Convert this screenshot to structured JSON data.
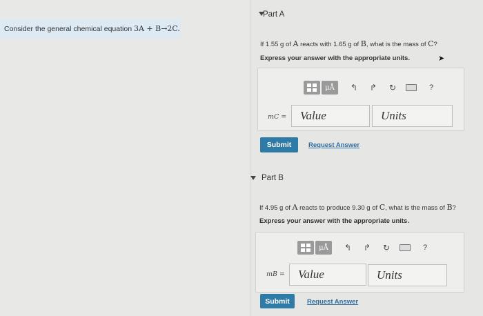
{
  "context": {
    "text": "Consider the general chemical equation ",
    "equation": "3A + B→2C."
  },
  "part_a": {
    "title": "Part A",
    "question_pre": "If 1.55 g of ",
    "q_a": "A",
    "question_mid1": " reacts with 1.65 g of ",
    "q_b": "B",
    "question_mid2": ", what is the mass of ",
    "q_c": "C",
    "question_end": "?",
    "instruction": "Express your answer with the appropriate units.",
    "var_label": "mC =",
    "value_placeholder": "Value",
    "units_placeholder": "Units",
    "submit_label": "Submit",
    "request_label": "Request Answer"
  },
  "part_b": {
    "title": "Part B",
    "question_pre": "If 4.95 g of ",
    "q_a": "A",
    "question_mid1": " reacts to produce 9.30 g of ",
    "q_c": "C",
    "question_mid2": ", what is the mass of ",
    "q_b": "B",
    "question_end": "?",
    "instruction": "Express your answer with the appropriate units.",
    "var_label": "mB =",
    "value_placeholder": "Value",
    "units_placeholder": "Units",
    "submit_label": "Submit",
    "request_label": "Request Answer"
  },
  "toolbar": {
    "mu_label": "μÅ",
    "undo_icon": "↰",
    "redo_icon": "↱",
    "reset_icon": "↻",
    "help_icon": "?"
  }
}
